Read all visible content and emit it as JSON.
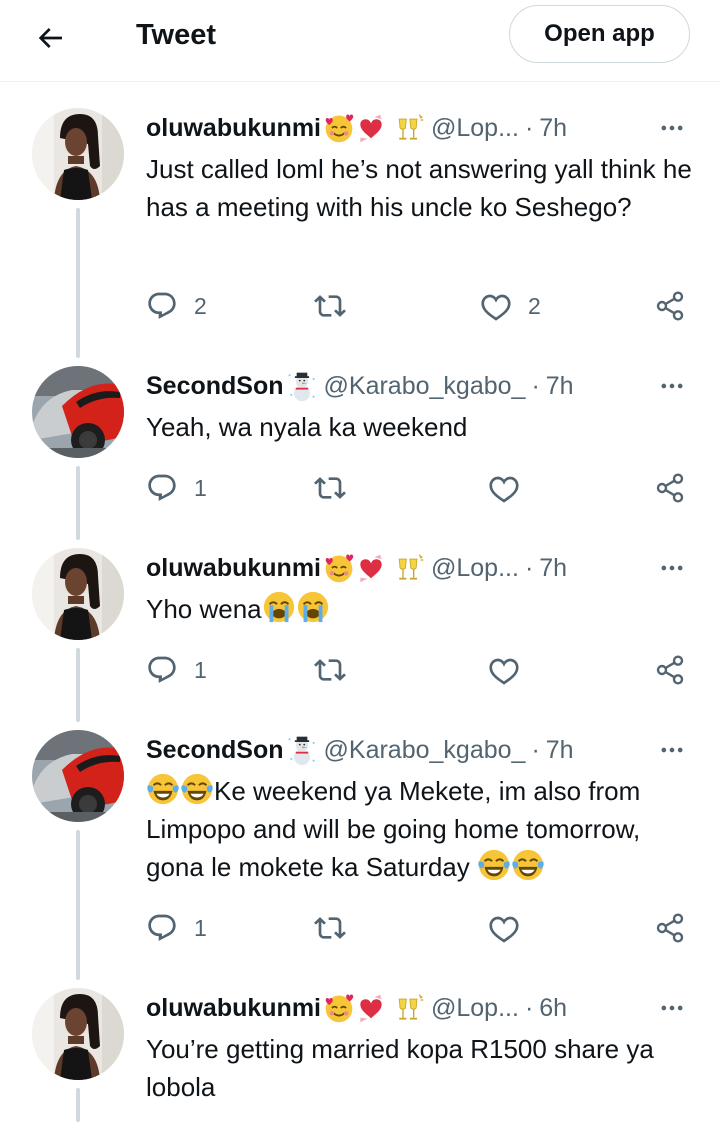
{
  "header": {
    "title": "Tweet",
    "open_app_label": "Open app"
  },
  "tweets": [
    {
      "name": "oluwabukunmi",
      "handle": "@Lop...",
      "time": "7h",
      "text": "Just called loml he’s not answering yall think he has a meeting with his uncle ko Seshego?",
      "replies": "2",
      "retweets": "",
      "likes": "2"
    },
    {
      "name": "SecondSon",
      "handle": "@Karabo_kgabo_",
      "time": "7h",
      "text": "Yeah, wa nyala ka weekend",
      "replies": "1",
      "retweets": "",
      "likes": ""
    },
    {
      "name": "oluwabukunmi",
      "handle": "@Lop...",
      "time": "7h",
      "text": "Yho wena",
      "replies": "1",
      "retweets": "",
      "likes": ""
    },
    {
      "name": "SecondSon",
      "handle": "@Karabo_kgabo_",
      "time": "7h",
      "text_lead": "Ke weekend ya Mekete, im also from",
      "text_line2": "Limpopo and will be going home tomorrow,",
      "text_line3": "gona le mokete ka Saturday",
      "replies": "1",
      "retweets": "",
      "likes": ""
    },
    {
      "name": "oluwabukunmi",
      "handle": "@Lop...",
      "time": "6h",
      "text": "You’re getting married kopa R1500 share ya lobola"
    }
  ],
  "icons": {
    "back": "arrow-left-icon",
    "more": "more-horizontal-icon",
    "reply": "reply-icon",
    "retweet": "retweet-icon",
    "like": "heart-icon",
    "share": "share-icon",
    "emoji_set_a": [
      "smiling-face-with-hearts",
      "heart-with-ribbon",
      "clinking-glasses"
    ],
    "emoji_set_b": [
      "snowman"
    ],
    "emoji_cry": "loudly-crying-face",
    "emoji_laugh": "face-with-tears-of-joy"
  },
  "colors": {
    "text": "#0f1419",
    "secondary": "#536471",
    "thread_line": "#cfd9de",
    "border": "#eff3f4"
  }
}
